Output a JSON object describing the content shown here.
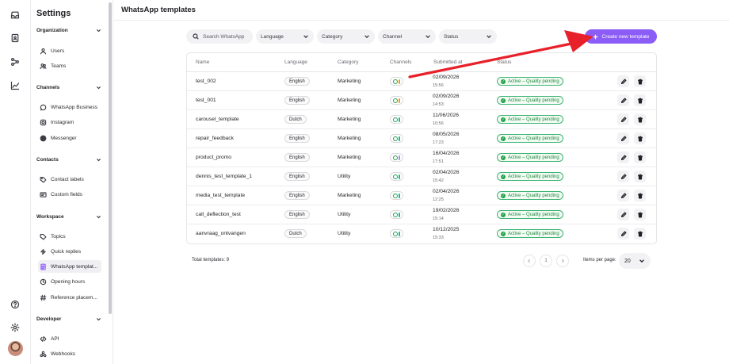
{
  "sidebar": {
    "title": "Settings",
    "sections": [
      {
        "label": "Organization",
        "items": [
          {
            "label": "Users",
            "icon": "user-icon"
          },
          {
            "label": "Teams",
            "icon": "users-icon"
          }
        ]
      },
      {
        "label": "Channels",
        "items": [
          {
            "label": "WhatsApp Business",
            "icon": "whatsapp-icon"
          },
          {
            "label": "Instagram",
            "icon": "instagram-icon"
          },
          {
            "label": "Messenger",
            "icon": "messenger-icon"
          }
        ]
      },
      {
        "label": "Contacts",
        "items": [
          {
            "label": "Contact labels",
            "icon": "tag-icon"
          },
          {
            "label": "Custom fields",
            "icon": "form-icon"
          }
        ]
      },
      {
        "label": "Workspace",
        "items": [
          {
            "label": "Topics",
            "icon": "topic-icon"
          },
          {
            "label": "Quick replies",
            "icon": "reply-icon"
          },
          {
            "label": "WhatsApp templat...",
            "icon": "template-icon",
            "active": true
          },
          {
            "label": "Opening hours",
            "icon": "clock-icon"
          },
          {
            "label": "Reference placem...",
            "icon": "hash-icon"
          }
        ]
      },
      {
        "label": "Developer",
        "items": [
          {
            "label": "API",
            "icon": "code-icon"
          },
          {
            "label": "Webhooks",
            "icon": "webhook-icon"
          }
        ]
      }
    ]
  },
  "page": {
    "title": "WhatsApp templates"
  },
  "filters": {
    "search_placeholder": "Search WhatsApp",
    "language": "Language",
    "category": "Category",
    "channel": "Channel",
    "status": "Status"
  },
  "create_button": "Create new template",
  "table": {
    "headers": {
      "name": "Name",
      "language": "Language",
      "category": "Category",
      "channels": "Channels",
      "submitted": "Submitted at",
      "status": "Status"
    },
    "rows": [
      {
        "name": "test_002",
        "language": "English",
        "category": "Marketing",
        "date": "02/09/2026",
        "time": "15:56",
        "status": "Active – Quality pending",
        "bar_color": "#f59e0b"
      },
      {
        "name": "test_001",
        "language": "English",
        "category": "Marketing",
        "date": "02/09/2026",
        "time": "14:53",
        "status": "Active – Quality pending",
        "bar_color": "#f59e0b"
      },
      {
        "name": "carousel_template",
        "language": "Dutch",
        "category": "Marketing",
        "date": "11/06/2026",
        "time": "10:56",
        "status": "Active – Quality pending",
        "bar_color": "#14b8a6"
      },
      {
        "name": "repair_feedback",
        "language": "English",
        "category": "Marketing",
        "date": "08/05/2026",
        "time": "17:23",
        "status": "Active – Quality pending",
        "bar_color": "#14b8a6"
      },
      {
        "name": "product_promo",
        "language": "English",
        "category": "Marketing",
        "date": "16/04/2026",
        "time": "17:51",
        "status": "Active – Quality pending",
        "bar_color": "#a78bfa"
      },
      {
        "name": "dennis_test_template_1",
        "language": "English",
        "category": "Utility",
        "date": "02/04/2026",
        "time": "15:42",
        "status": "Active – Quality pending",
        "bar_color": "#14b8a6"
      },
      {
        "name": "media_test_template",
        "language": "English",
        "category": "Marketing",
        "date": "02/04/2026",
        "time": "12:25",
        "status": "Active – Quality pending",
        "bar_color": "#14b8a6"
      },
      {
        "name": "call_deflection_test",
        "language": "English",
        "category": "Utility",
        "date": "19/02/2026",
        "time": "15:14",
        "status": "Active – Quality pending",
        "bar_color": "#14b8a6"
      },
      {
        "name": "aanvraag_ontvangen",
        "language": "Dutch",
        "category": "Utility",
        "date": "10/12/2025",
        "time": "15:33",
        "status": "Active – Quality pending",
        "bar_color": "#14b8a6"
      }
    ]
  },
  "footer": {
    "total": "Total templates: 9",
    "page": "1",
    "items_per_page_label": "Items per page:",
    "items_per_page": "20"
  },
  "colors": {
    "accent": "#8b5cf6",
    "annotation_arrow": "#e8202a",
    "status_green": "#22a447"
  }
}
